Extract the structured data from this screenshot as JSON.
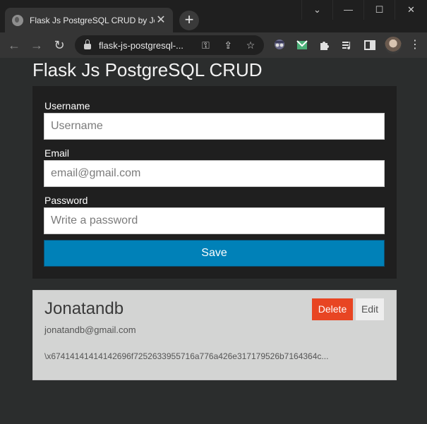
{
  "browser": {
    "tab_title": "Flask Js PostgreSQL CRUD by Jon",
    "tab_close": "✕",
    "new_tab": "+",
    "window_controls": {
      "dropdown": "⌄",
      "minimize": "—",
      "maximize": "☐",
      "close": "✕"
    },
    "nav": {
      "back": "←",
      "forward": "→",
      "reload": "↻"
    },
    "url": "flask-js-postgresql-...",
    "omnibox_icons": {
      "key": "⚿",
      "share": "⇪",
      "star": "☆"
    },
    "extensions": [
      "spy-icon",
      "mail-icon",
      "puzzle-icon",
      "media-icon",
      "sidebar-icon"
    ],
    "menu": "⋮"
  },
  "page": {
    "title": "Flask Js PostgreSQL CRUD"
  },
  "form": {
    "username_label": "Username",
    "username_placeholder": "Username",
    "email_label": "Email",
    "email_placeholder": "email@gmail.com",
    "password_label": "Password",
    "password_placeholder": "Write a password",
    "save_label": "Save"
  },
  "users": [
    {
      "name": "Jonatandb",
      "email": "jonatandb@gmail.com",
      "hash": "\\x67414141414142696f7252633955716a776a426e317179526b7164364c...",
      "delete_label": "Delete",
      "edit_label": "Edit"
    }
  ],
  "colors": {
    "accent": "#0081b8",
    "danger": "#e84523",
    "page_bg": "#2b2d2d",
    "card_bg": "#1f1f1f"
  }
}
